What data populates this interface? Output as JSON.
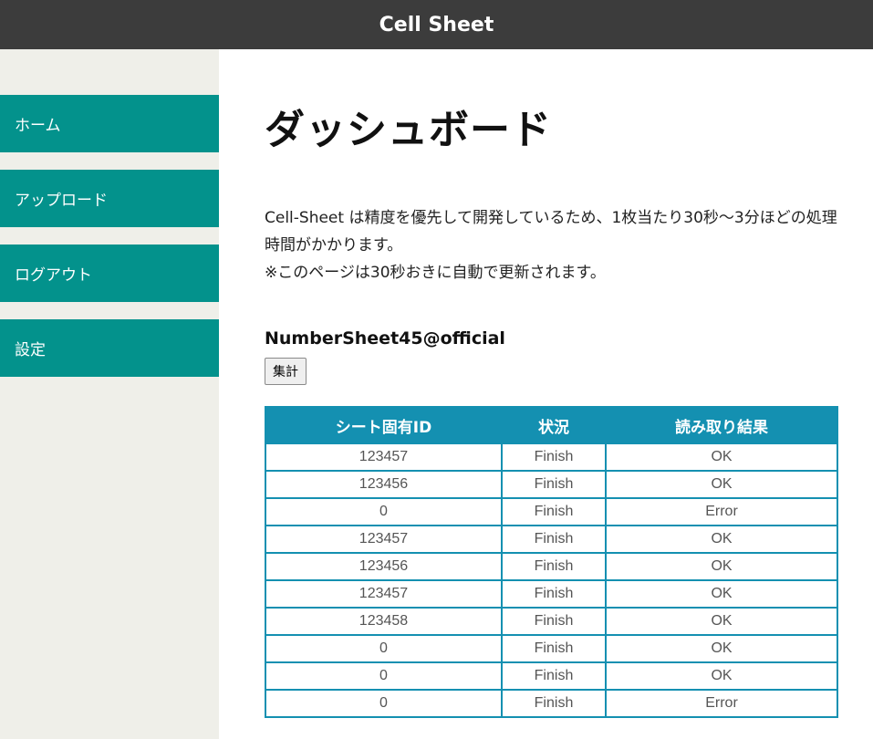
{
  "app": {
    "title": "Cell Sheet"
  },
  "sidebar": {
    "items": [
      {
        "label": "ホーム"
      },
      {
        "label": "アップロード"
      },
      {
        "label": "ログアウト"
      },
      {
        "label": "設定"
      }
    ]
  },
  "main": {
    "title": "ダッシュボード",
    "description_line1": "Cell-Sheet は精度を優先して開発しているため、1枚当たり30秒〜3分ほどの処理時間がかかります。",
    "description_line2": "※このページは30秒おきに自動で更新されます。",
    "sheet_name": "NumberSheet45@official",
    "aggregate_button": "集計"
  },
  "table": {
    "headers": [
      "シート固有ID",
      "状況",
      "読み取り結果"
    ],
    "rows": [
      [
        "123457",
        "Finish",
        "OK"
      ],
      [
        "123456",
        "Finish",
        "OK"
      ],
      [
        "0",
        "Finish",
        "Error"
      ],
      [
        "123457",
        "Finish",
        "OK"
      ],
      [
        "123456",
        "Finish",
        "OK"
      ],
      [
        "123457",
        "Finish",
        "OK"
      ],
      [
        "123458",
        "Finish",
        "OK"
      ],
      [
        "0",
        "Finish",
        "OK"
      ],
      [
        "0",
        "Finish",
        "OK"
      ],
      [
        "0",
        "Finish",
        "Error"
      ]
    ]
  },
  "colors": {
    "topbar": "#3c3c3c",
    "sidebar_bg": "#efefe9",
    "nav_item": "#03928c",
    "table_accent": "#1490b1"
  }
}
